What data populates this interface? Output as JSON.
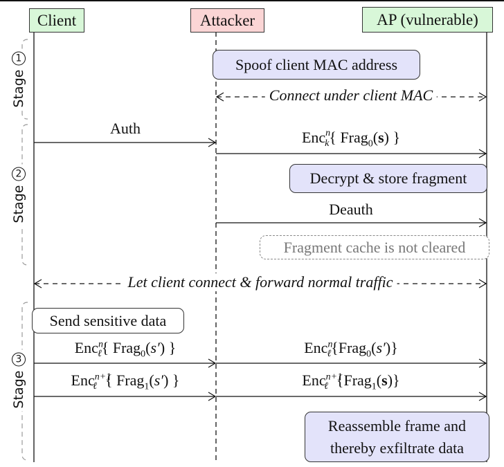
{
  "actors": {
    "client": "Client",
    "attacker": "Attacker",
    "ap": "AP (vulnerable)"
  },
  "colors": {
    "client_fill": "#d8f7d8",
    "attacker_fill": "#fbd5d5",
    "ap_fill": "#d8f7d8",
    "note_fill": "#e3e3fa",
    "cache_text": "#777777"
  },
  "stages": [
    {
      "label": "Stage",
      "number": "1"
    },
    {
      "label": "Stage",
      "number": "2"
    },
    {
      "label": "Stage",
      "number": "3"
    }
  ],
  "stage1": {
    "spoof_note": "Spoof client MAC address",
    "connect": "Connect under client MAC"
  },
  "stage2": {
    "auth": "Auth",
    "enc_k": {
      "base": "Enc",
      "sup": "n",
      "sub": "k",
      "frag": "Frag",
      "frag_sub": "0",
      "arg": "s"
    },
    "decrypt_note": "Decrypt & store fragment",
    "deauth": "Deauth",
    "cache_note": "Fragment cache is not cleared"
  },
  "forward": "Let client connect & forward normal traffic",
  "stage3": {
    "send_note": "Send sensitive data",
    "msg1_left": {
      "base": "Enc",
      "sup": "n",
      "sub": "ℓ",
      "frag": "Frag",
      "frag_sub": "0",
      "arg": "s′"
    },
    "msg1_right": {
      "base": "Enc",
      "sup": "n",
      "sub": "ℓ",
      "frag": "Frag",
      "frag_sub": "0",
      "arg": "s′"
    },
    "msg2_left": {
      "base": "Enc",
      "sup": "n+1",
      "sub": "ℓ",
      "frag": "Frag",
      "frag_sub": "1",
      "arg": "s′"
    },
    "msg2_right": {
      "base": "Enc",
      "sup": "n+1",
      "sub": "ℓ",
      "frag": "Frag",
      "frag_sub": "1",
      "arg": "s"
    },
    "reassemble_line1": "Reassemble frame and",
    "reassemble_line2": "thereby exfiltrate data"
  }
}
